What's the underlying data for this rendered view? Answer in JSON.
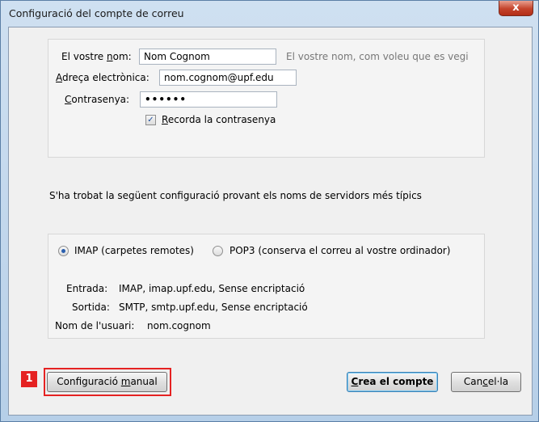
{
  "window": {
    "title": "Configuració del compte de correu",
    "close_label": "x"
  },
  "identity": {
    "name_label_pre": "El vostre ",
    "name_label_key": "n",
    "name_label_post": "om:",
    "name_value": "Nom Cognom",
    "name_hint": "El vostre nom, com voleu que es vegi",
    "email_label_key": "A",
    "email_label_post": "dreça electrònica:",
    "email_value": "nom.cognom@upf.edu",
    "password_label_key": "C",
    "password_label_post": "ontrasenya:",
    "password_value": "••••••",
    "remember_checked": true,
    "remember_check_glyph": "✓",
    "remember_label_key": "R",
    "remember_label_post": "ecorda la contrasenya"
  },
  "found_message": "S'ha trobat la següent configuració provant els noms de servidors més típics",
  "protocol": {
    "imap_label": "IMAP (carpetes remotes)",
    "pop3_label": "POP3 (conserva el correu al vostre ordinador)",
    "selected": "IMAP"
  },
  "server_details": {
    "incoming_label": "Entrada:",
    "incoming_value": "IMAP, imap.upf.edu, Sense encriptació",
    "outgoing_label": "Sortida:",
    "outgoing_value": "SMTP, smtp.upf.edu, Sense encriptació",
    "username_label": "Nom de l'usuari:",
    "username_value": "nom.cognom"
  },
  "buttons": {
    "manual_pre": "Configuració ",
    "manual_key": "m",
    "manual_post": "anual",
    "create_key": "C",
    "create_post": "rea el compte",
    "cancel_pre": "Can",
    "cancel_key": "c",
    "cancel_post": "el·la"
  },
  "annotation": {
    "step_number": "1",
    "color": "#e52222"
  }
}
